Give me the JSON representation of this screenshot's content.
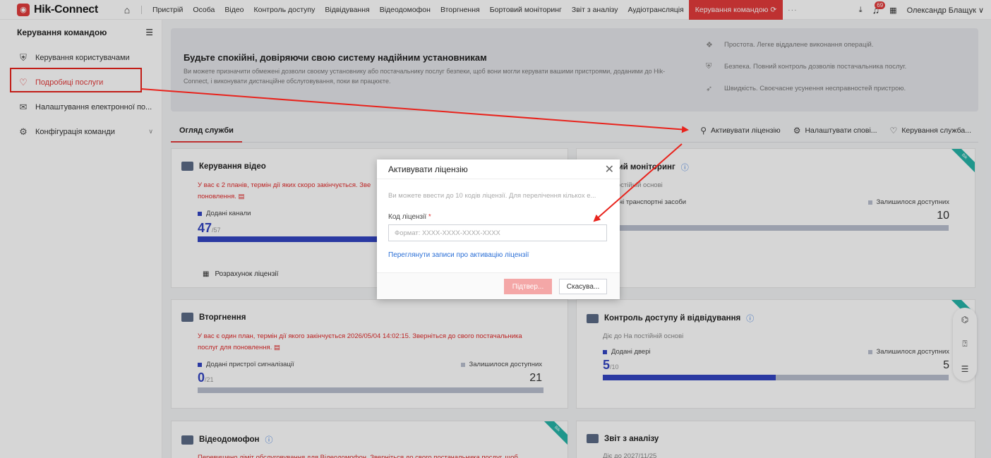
{
  "brand": {
    "logo_letter": "◉",
    "name": "Hik-Connect"
  },
  "nav": {
    "items": [
      "Пристрій",
      "Особа",
      "Відео",
      "Контроль доступу",
      "Відвідування",
      "Відеодомофон",
      "Вторгнення",
      "Бортовий моніторинг",
      "Звіт з аналізу",
      "Аудіотрансляція"
    ],
    "active": "Керування командою ⟳",
    "more": "···"
  },
  "top_right": {
    "notif_count": "69",
    "user": "Олександр Блащук ∨"
  },
  "sidebar": {
    "title": "Керування командою",
    "items": [
      {
        "label": "Керування користувачами",
        "icon": "shield-icon"
      },
      {
        "label": "Подробиці послуги",
        "icon": "heart-icon"
      },
      {
        "label": "Налаштування електронної по...",
        "icon": "email-icon"
      },
      {
        "label": "Конфігурація команди",
        "icon": "gear-icon"
      }
    ]
  },
  "banner": {
    "title": "Будьте спокійні, довіряючи свою систему надійним установникам",
    "desc": "Ви можете призначити обмежені дозволи своєму установнику або постачальнику послуг безпеки, щоб вони могли керувати вашими пристроями, доданими до Hik-Connect, і виконувати дистанційне обслуговування, поки ви працюєте.",
    "features": [
      "Простота. Легке віддалене виконання операцій.",
      "Безпека. Повний контроль дозволів постачальника послуг.",
      "Швидкість. Своєчасне усунення несправностей пристрою."
    ]
  },
  "tabs": {
    "active": "Огляд служби",
    "actions": [
      "Активувати ліцензію",
      "Налаштувати сповi...",
      "Керування служба..."
    ]
  },
  "cards": {
    "video": {
      "title": "Керування відео",
      "warn_1": "У вас є 2 планів, термін дії яких скоро закінчується. Зве",
      "warn_2": "поновлення.",
      "legend": "Додані канали",
      "value": "47",
      "total": "/57",
      "fill": 0.82,
      "calc": "Розрахунок ліцензії"
    },
    "onboard": {
      "title": "товий моніторинг",
      "sub": "На постійній основі",
      "legend_left": "дані транспортні засоби",
      "legend_right": "Залишилося доступних",
      "value_left": "0",
      "remaining": "10",
      "fill": 0.0
    },
    "intrusion": {
      "title": "Вторгнення",
      "warn_1": "У вас є один план, термін дії якого закінчується 2026/05/04 14:02:15. Зверніться до свого постачальника",
      "warn_2": "послуг для поновлення.",
      "legend_left": "Додані пристрої сигналізації",
      "legend_right": "Залишилося доступних",
      "value": "0",
      "total": "/21",
      "remaining": "21",
      "fill": 0.0
    },
    "access": {
      "title": "Контроль доступу й відвідування",
      "sub": "Діє до На постійній основі",
      "legend_left": "Додані двері",
      "legend_right": "Залишилося доступних",
      "value": "5",
      "total": "/10",
      "remaining": "5",
      "fill": 0.5
    },
    "intercom": {
      "title": "Відеодомофон",
      "warn_1": "Перевищено ліміт обслуговування для Відеодомофон. Зверніться до свого постачальника послуг, щоб"
    },
    "report": {
      "title": "Звіт з аналізу",
      "sub": "Діє до 2027/11/25"
    }
  },
  "modal": {
    "title": "Активувати ліцензію",
    "hint": "Ви можете ввести до 10 кодів ліцензії. Для перелічення кількох е...",
    "label": "Код ліцензії",
    "required_mark": "*",
    "placeholder": "Формат: XXXX-XXXX-XXXX-XXXX",
    "value": "",
    "link": "Переглянути записи про активацію ліцензії",
    "ok": "Підтвер...",
    "cancel": "Скасува..."
  },
  "colors": {
    "accent": "#e33b3b",
    "primary_bar": "#3345c2",
    "annotation": "#e8231c"
  }
}
